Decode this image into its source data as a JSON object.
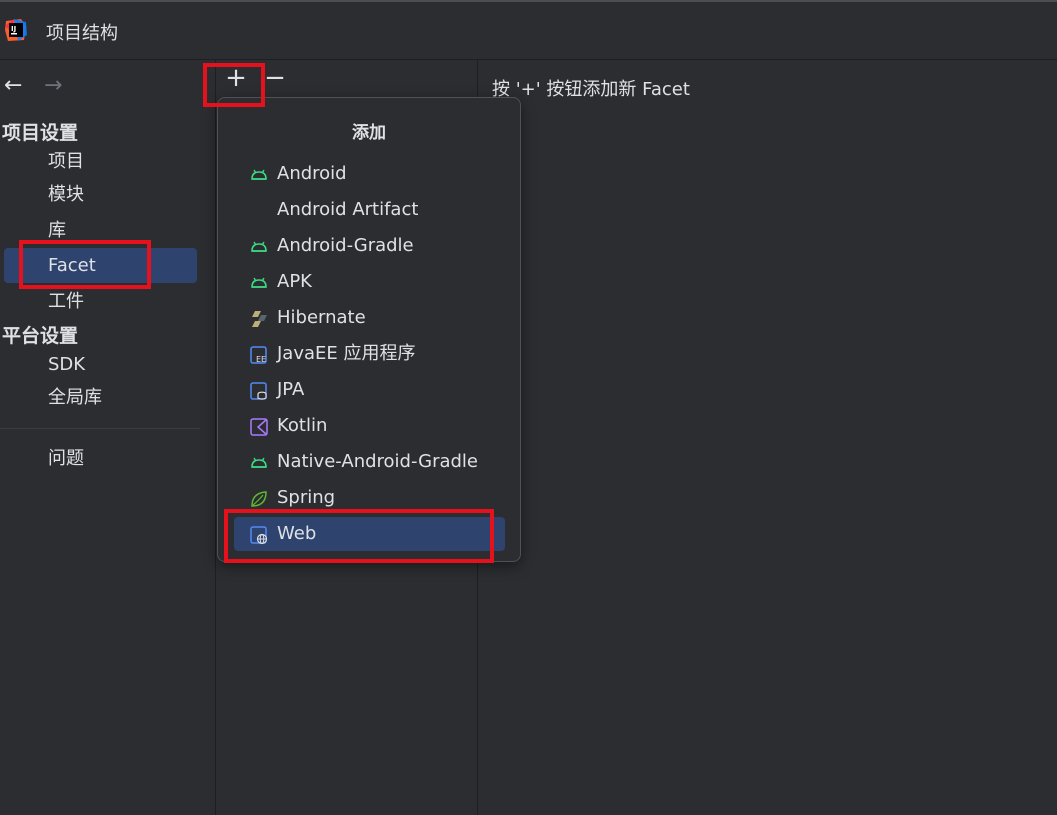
{
  "window": {
    "title": "项目结构"
  },
  "nav": {
    "back": "←",
    "forward": "→"
  },
  "sidebar": {
    "project_settings_header": "项目设置",
    "platform_settings_header": "平台设置",
    "items": [
      {
        "label": "项目"
      },
      {
        "label": "模块"
      },
      {
        "label": "库"
      },
      {
        "label": "Facet",
        "selected": true
      },
      {
        "label": "工件"
      },
      {
        "label": "SDK"
      },
      {
        "label": "全局库"
      },
      {
        "label": "问题"
      }
    ]
  },
  "toolbar": {
    "add": "+",
    "remove": "−"
  },
  "hint": "按 '+' 按钮添加新 Facet",
  "popup": {
    "title": "添加",
    "items": [
      {
        "label": "Android",
        "icon": "android-icon"
      },
      {
        "label": "Android Artifact",
        "icon": ""
      },
      {
        "label": "Android-Gradle",
        "icon": "android-icon"
      },
      {
        "label": "APK",
        "icon": "android-icon"
      },
      {
        "label": "Hibernate",
        "icon": "hibernate-icon"
      },
      {
        "label": "JavaEE 应用程序",
        "icon": "javaee-icon",
        "icon_text": "EE"
      },
      {
        "label": "JPA",
        "icon": "jpa-icon"
      },
      {
        "label": "Kotlin",
        "icon": "kotlin-icon"
      },
      {
        "label": "Native-Android-Gradle",
        "icon": "android-icon"
      },
      {
        "label": "Spring",
        "icon": "spring-icon"
      },
      {
        "label": "Web",
        "icon": "web-icon",
        "selected": true
      }
    ]
  },
  "colors": {
    "background": "#2b2d30",
    "selection": "#2e436e",
    "highlight": "#e5121d",
    "android_green": "#3ddc84",
    "link_blue": "#548af7",
    "kotlin_purple": "#a97bff"
  }
}
